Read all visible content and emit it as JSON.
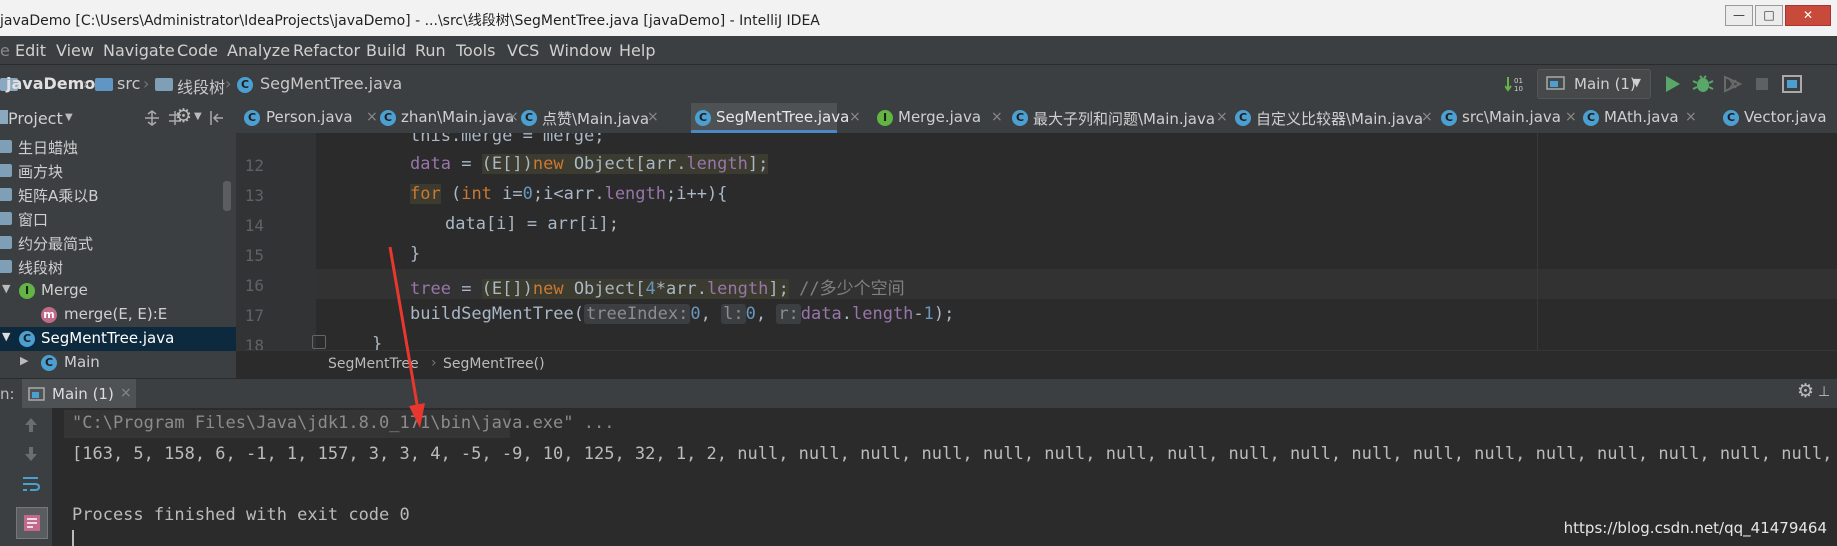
{
  "window": {
    "title": "javaDemo [C:\\Users\\Administrator\\IdeaProjects\\javaDemo] - ...\\src\\线段树\\SegMentTree.java [javaDemo] - IntelliJ IDEA"
  },
  "menu": [
    "Edit",
    "View",
    "Navigate",
    "Code",
    "Analyze",
    "Refactor",
    "Build",
    "Run",
    "Tools",
    "VCS",
    "Window",
    "Help"
  ],
  "breadcrumb": {
    "project": "javaDemo",
    "src": "src",
    "pkg": "线段树",
    "file": "SegMentTree.java"
  },
  "run_config": {
    "label": "Main (1)"
  },
  "project_panel": {
    "title": "Project",
    "items": [
      {
        "label": "生日蜡烛",
        "type": "folder"
      },
      {
        "label": "画方块",
        "type": "folder"
      },
      {
        "label": "矩阵A乘以B",
        "type": "folder"
      },
      {
        "label": "窗口",
        "type": "folder"
      },
      {
        "label": "约分最简式",
        "type": "folder"
      },
      {
        "label": "线段树",
        "type": "folder"
      },
      {
        "label": "Merge",
        "type": "interface"
      },
      {
        "label": "merge(E, E):E",
        "type": "method"
      },
      {
        "label": "SegMentTree.java",
        "type": "class"
      },
      {
        "label": "Main",
        "type": "class"
      }
    ]
  },
  "tabs": [
    {
      "label": "Person.java"
    },
    {
      "label": "zhan\\Main.java"
    },
    {
      "label": "点赞\\Main.java"
    },
    {
      "label": "SegMentTree.java",
      "active": true
    },
    {
      "label": "Merge.java"
    },
    {
      "label": "最大子列和问题\\Main.java"
    },
    {
      "label": "自定义比较器\\Main.java"
    },
    {
      "label": "src\\Main.java"
    },
    {
      "label": "MAth.java"
    },
    {
      "label": "Vector.java"
    }
  ],
  "editor": {
    "line_numbers": [
      "12",
      "13",
      "14",
      "15",
      "16",
      "17",
      "18"
    ],
    "line11_text": "this.merge = merge;",
    "tok": {
      "data": "data",
      "eq": " = ",
      "cast": "(E[])",
      "new": "new",
      "object": " Object[",
      "arr": "arr",
      "dot": ".",
      "length": "length",
      "close": "];",
      "for": "for",
      "for_rest1": " (",
      "int": "int",
      "for_rest2": " i=",
      "zero": "0",
      "for_rest3": ";i<",
      "for_rest4": ";i++){",
      "assign": "data[i] = arr[i];",
      "brace": "}",
      "tree": "tree",
      "four": "4",
      "times": "*",
      "comment": "//多少个空间",
      "build": "buildSegMentTree(",
      "hint_treeIndex": "treeIndex:",
      "hint_l": "l:",
      "hint_r": "r:",
      "comma": ", ",
      "length_minus": "-",
      "one": "1",
      "end": ");",
      "close_brace": "}"
    }
  },
  "editor_crumbs": {
    "cls": "SegMentTree",
    "method": "SegMentTree()"
  },
  "run_panel": {
    "prefix": "n:",
    "tab": "Main (1)"
  },
  "console": {
    "cmd": "\"C:\\Program Files\\Java\\jdk1.8.0_171\\bin\\java.exe\" ...",
    "output": "[163, 5, 158, 6, -1, 1, 157, 3, 3, 4, -5, -9, 10, 125, 32, 1, 2, null, null, null, null, null, null, null, null, null, null, null, null, null, null, null, null, null, null, null",
    "exit": "Process finished with exit code 0"
  },
  "watermark": "https://blog.csdn.net/qq_41479464"
}
